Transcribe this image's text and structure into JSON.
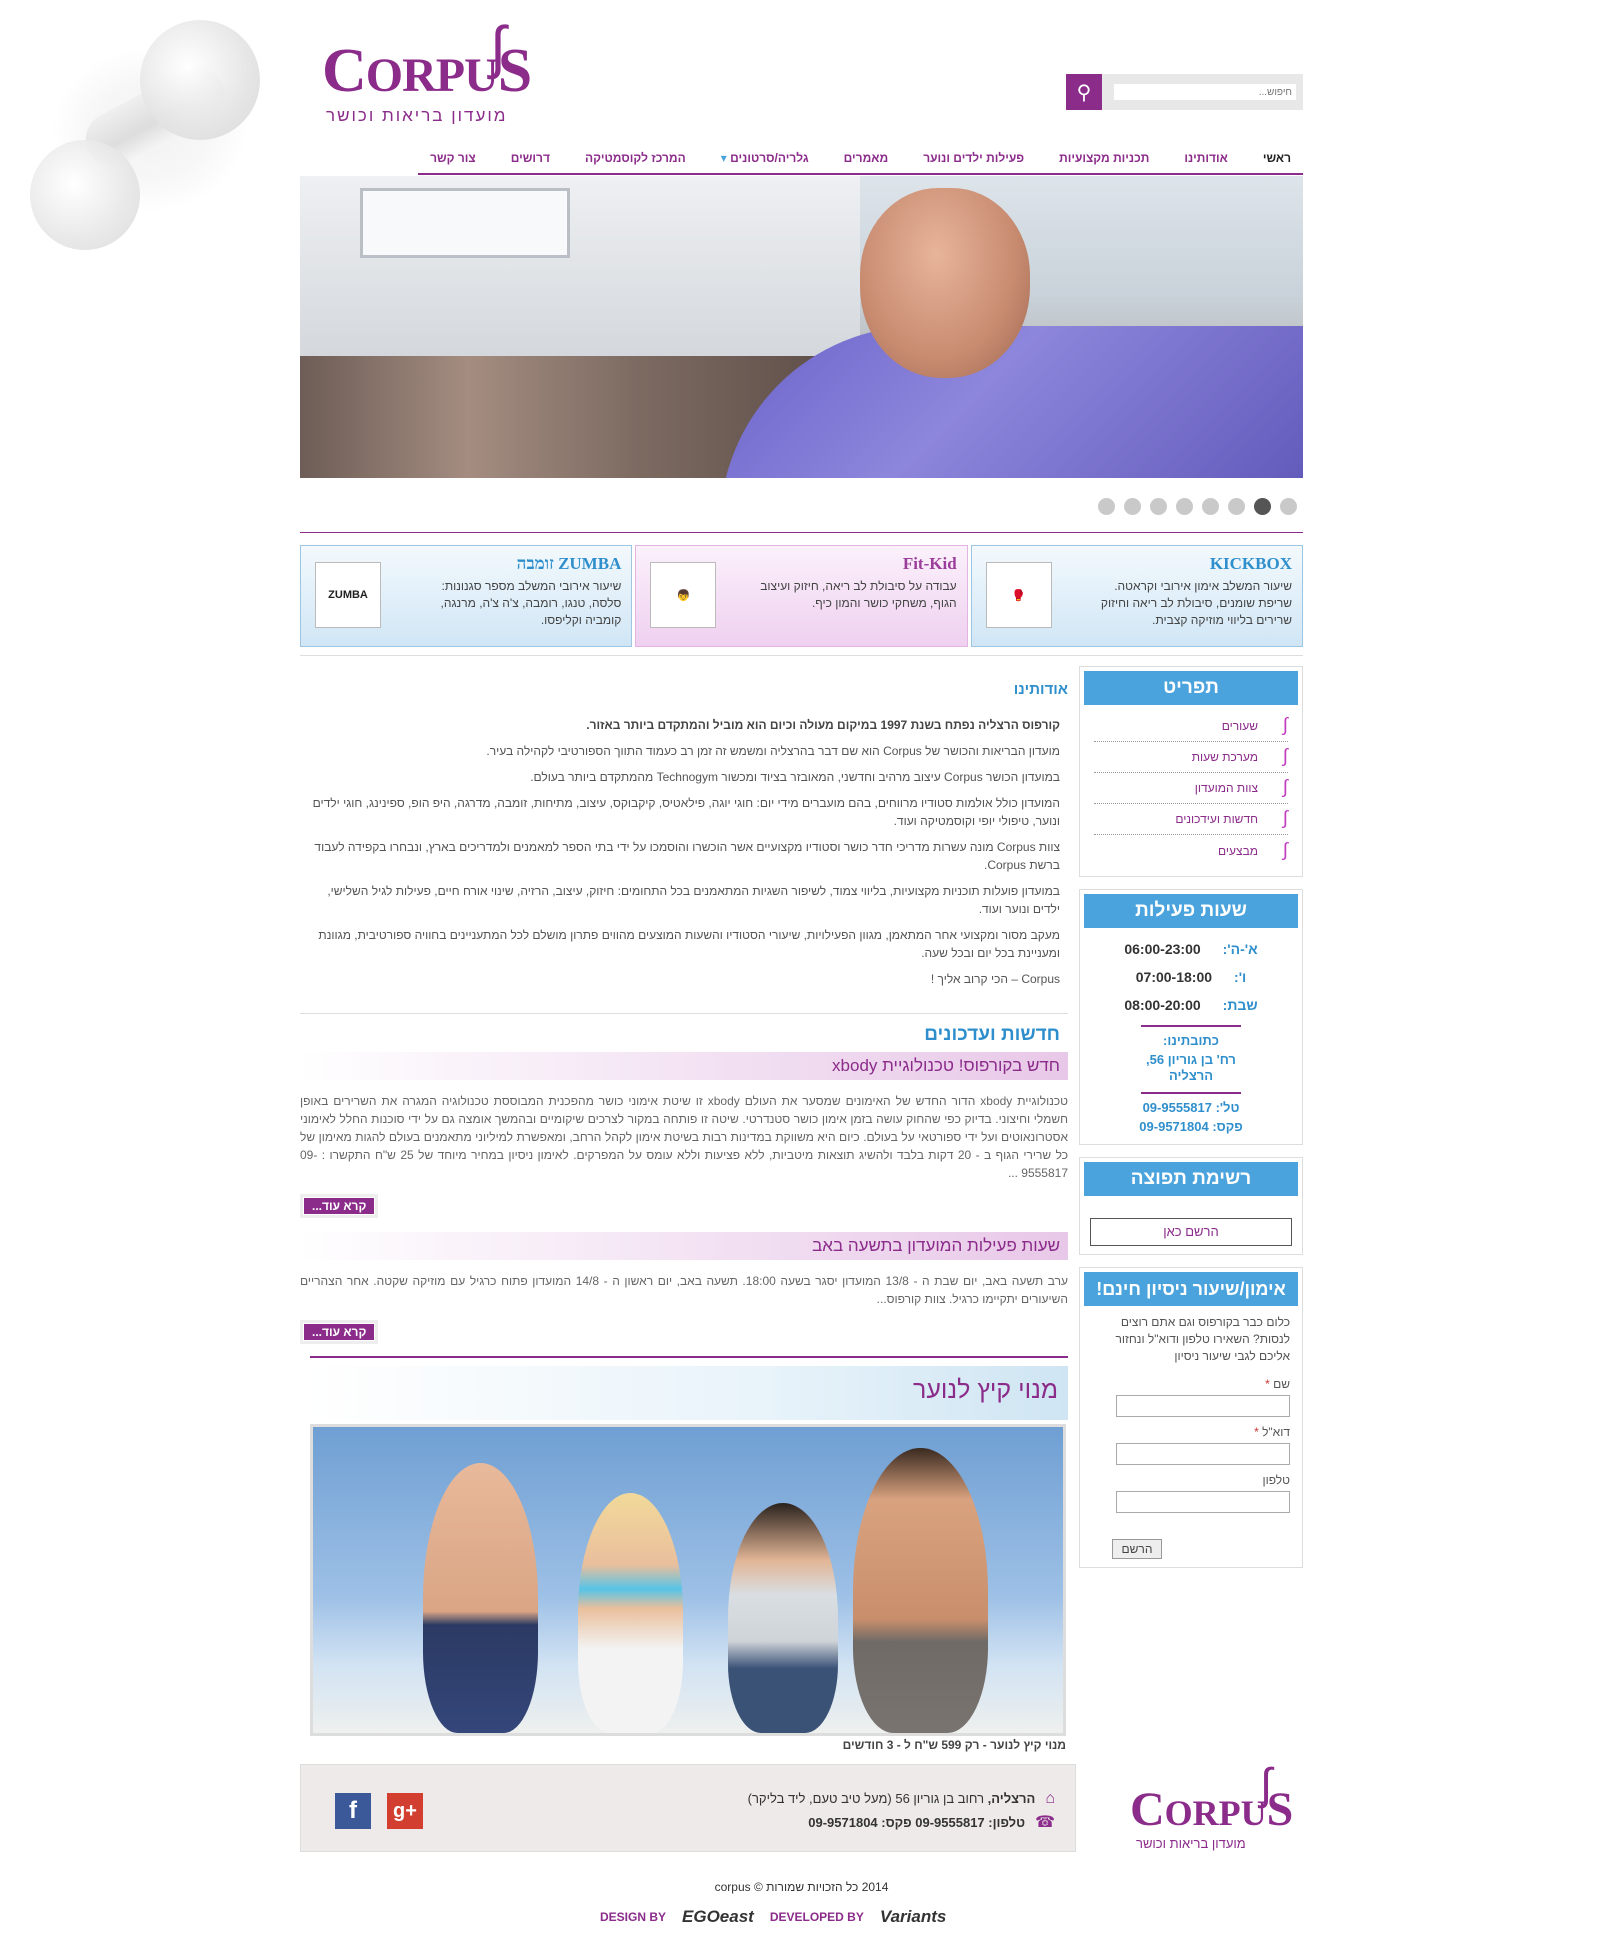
{
  "brand": {
    "logo_text": "CORPUS",
    "tagline": "מועדון בריאות וכושר"
  },
  "search": {
    "placeholder": "חיפוש..."
  },
  "nav": [
    "ראשי",
    "אודותינו",
    "תכניות מקצועיות",
    "פעילות ילדים ונוער",
    "מאמרים",
    "גלריה/סרטונים",
    "המרכז לקוסמטיקה",
    "דרושים",
    "צור קשר"
  ],
  "promos": [
    {
      "title": "KICKBOX",
      "text": "שיעור המשלב אימון אירובי וקראטה. שריפת שומנים, סיבולת לב ריאה וחיזוק שרירים בליווי מוזיקה קצבית."
    },
    {
      "title": "Fit-Kid",
      "text": "עבודה על סיבולת לב ריאה, חיזוק ועיצוב הגוף, משחקי כושר והמון כיף."
    },
    {
      "title": "ZUMBA זומבה",
      "text": "שיעור אירובי המשלב מספר סגנונות: סלסה, טנגו, רומבה, צ'ה צ'ה, מרנגה, קומביה וקליפסו.",
      "thumb": "ZUMBA"
    }
  ],
  "about": {
    "title": "אודותינו",
    "lead": "קורפוס הרצליה נפתח בשנת 1997 במיקום מעולה וכיום הוא מוביל והמתקדם ביותר באזור.",
    "paragraphs": [
      "מועדון הבריאות והכושר של Corpus הוא שם דבר בהרצליה ומשמש זה זמן רב כעמוד התווך הספורטיבי לקהילה בעיר.",
      "במועדון הכושר Corpus עיצוב מרהיב וחדשני, המאובזר בציוד ומכשור Technogym מהמתקדם ביותר בעולם.",
      "המועדון כולל אולמות סטודיו מרווחים, בהם מועברים מידי יום: חוגי יוגה, פילאטיס, קיקבוקס, עיצוב, מתיחות, זומבה, מדרגה, היפ הופ, ספינינג, חוגי ילדים ונוער, טיפולי יופי וקוסמטיקה ועוד.",
      "צוות Corpus מונה עשרות מדריכי חדר כושר וסטודיו מקצועיים אשר הוכשרו והוסמכו על ידי בתי הספר למאמנים ולמדריכים בארץ, ונבחרו בקפידה לעבוד ברשת Corpus.",
      "במועדון פועלות תוכניות מקצועיות, בליווי צמוד, לשיפור השגיות המתאמנים בכל התחומים: חיזוק, עיצוב, הרזיה, שינוי אורח חיים, פעילות לגיל השלישי, ילדים ונוער ועוד.",
      "מעקב מסור ומקצועי אחר המתאמן, מגוון הפעילויות, שיעורי הסטודיו והשעות המוצעים מהווים פתרון מושלם לכל המתעניינים בחוויה ספורטיבית, מגוונת ומעניינת בכל יום ובכל שעה.",
      "Corpus – הכי קרוב אליך !"
    ]
  },
  "news": {
    "title": "חדשות ועדכונים",
    "items": [
      {
        "headline": "חדש בקורפוס! טכנולוגיית xbody",
        "body": "טכנולוגיית xbody הדור החדש של האימונים שמסער את העולם xbody זו שיטת אימוני כושר מהפכנית המבוססת טכנולוגיה המגרה את השרירים באופן חשמלי וחיצוני. בדיוק כפי שהחוק עושה בזמן אימון כושר סטנדרטי. שיטה זו פותחה במקור לצרכים שיקומיים ובהמשך אומצה גם על ידי סוכנות החלל לאימוני אסטרונאוטים ועל ידי ספורטאי על בעולם. כיום היא משווקת במדינות רבות בשיטת אימון לקהל הרחב, ומאפשרת למיליוני מתאמנים בעולם להגות מאימון של כל שרירי הגוף ב - 20 דקות בלבד ולהשיג תוצאות מיטביות, ללא פציעות וללא עומס על המפרקים. לאימון ניסיון במחיר מיוחד של 25 ש\"ח התקשרו : 09-9555817 ...",
        "more": "קרא עוד..."
      },
      {
        "headline": "שעות פעילות המועדון בתשעה באב",
        "body": "ערב תשעה באב, יום שבת ה - 13/8 המועדון יסגר בשעה 18:00. תשעה באב, יום ראשון ה - 14/8 המועדון פתוח כרגיל עם מוזיקה שקטה. אחר הצהריים השיעורים יתקיימו כרגיל. צוות קורפוס...",
        "more": "קרא עוד..."
      }
    ]
  },
  "summer": {
    "title": "מנוי קיץ לנוער",
    "caption_link": "מנוי קיץ לנוער",
    "caption_rest": " - רק 599 ש\"ח ל - 3 חודשים"
  },
  "sidebar": {
    "menu_title": "תפריט",
    "menu": [
      "שעורים",
      "מערכת שעות",
      "צוות המועדון",
      "חדשות ועידכונים",
      "מבצעים"
    ],
    "hours_title": "שעות פעילות",
    "hours": [
      {
        "day": "א'-ה':",
        "time": "06:00-23:00"
      },
      {
        "day": "ו':",
        "time": "07:00-18:00"
      },
      {
        "day": "שבת:",
        "time": "08:00-20:00"
      }
    ],
    "address_label": "כתובתינו:",
    "address": "רח' בן גוריון 56, הרצליה",
    "phone": "טל': 09-9555817",
    "fax": "פקס: 09-9571804",
    "newsletter_title": "רשימת תפוצה",
    "newsletter_field": "הרשם כאן",
    "trial_title": "אימון/שיעור ניסיון חינם!",
    "trial_text": "כלום כבר בקורפוס וגם אתם רוצים לנסות? השאירו טלפון ודוא\"ל ונחזור אליכם לגבי שיעור ניסיון",
    "name_label": "שם ",
    "email_label": "דוא\"ל ",
    "phone_label": "טלפון",
    "submit": "הרשם"
  },
  "footer": {
    "city": "הרצליה,",
    "address": " רחוב בן גוריון 56 (מעל טיב טעם, ליד בליקר)",
    "phone_line": "טלפון: 09-9555817  פקס: 09-9571804",
    "copyright": "2014 כל הזכויות שמורות © corpus",
    "design": "DESIGN BY",
    "design_co": "EGOeast",
    "developed": "DEVELOPED BY",
    "developed_co": "Variants"
  }
}
